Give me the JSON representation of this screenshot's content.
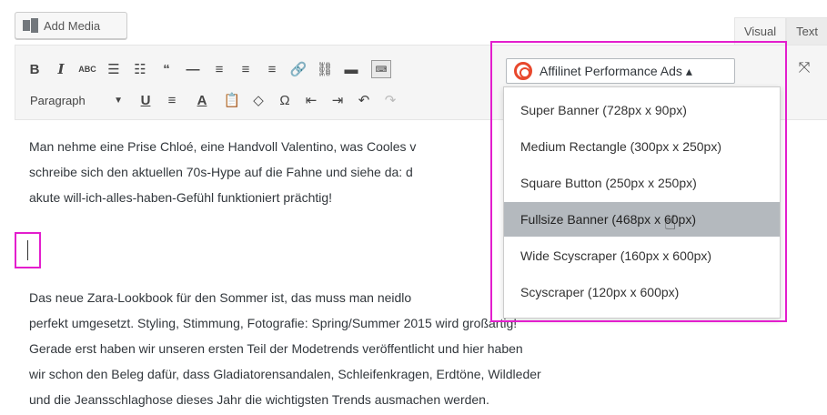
{
  "toolbar_top": {
    "add_media_label": "Add Media",
    "tabs": [
      {
        "label": "Visual"
      },
      {
        "label": "Text"
      }
    ]
  },
  "toolbar": {
    "row1_buttons": [
      "B",
      "I",
      "ABC",
      "☰",
      "☷",
      "“",
      "—",
      "≡",
      "≡",
      "≡",
      "🔗",
      "⛓",
      "▬",
      "⌨"
    ],
    "row2_format_select": "Paragraph",
    "row2_buttons": [
      "U",
      "≡",
      "A",
      "📋",
      "◇",
      "Ω",
      "⇤",
      "⇥",
      "↶",
      "↷"
    ]
  },
  "affilinet": {
    "button_label": "Affilinet Performance Ads ▴",
    "icon": "affilinet-target-icon",
    "accent_color": "#e8482d",
    "menu": [
      {
        "label": "Super Banner (728px x 90px)"
      },
      {
        "label": "Medium Rectangle (300px x 250px)"
      },
      {
        "label": "Square Button (250px x 250px)"
      },
      {
        "label": "Fullsize Banner (468px x 60px)"
      },
      {
        "label": "Wide Scyscraper (160px x 600px)"
      },
      {
        "label": "Scyscraper (120px x 600px)"
      }
    ]
  },
  "content": {
    "para1": [
      "Man nehme eine Prise Chloé, eine Handvoll Valentino, was Cooles v",
      "schreibe sich den aktuellen 70s-Hype auf die Fahne und siehe da: d",
      "akute will-ich-alles-haben-Gefühl funktioniert prächtig!"
    ],
    "para2": [
      "Das neue Zara-Lookbook für den Sommer ist, das muss man neidlo",
      "perfekt umgesetzt. Styling, Stimmung, Fotografie: Spring/Summer 2015 wird großartig!",
      "Gerade erst haben wir unseren ersten Teil der Modetrends veröffentlicht und hier haben",
      "wir schon den Beleg dafür, dass Gladiatorensandalen, Schleifenkragen, Erdtöne, Wildleder",
      "und die Jeansschlaghose dieses Jahr die wichtigsten Trends ausmachen werden."
    ]
  },
  "highlight_color": "#e31ecd"
}
